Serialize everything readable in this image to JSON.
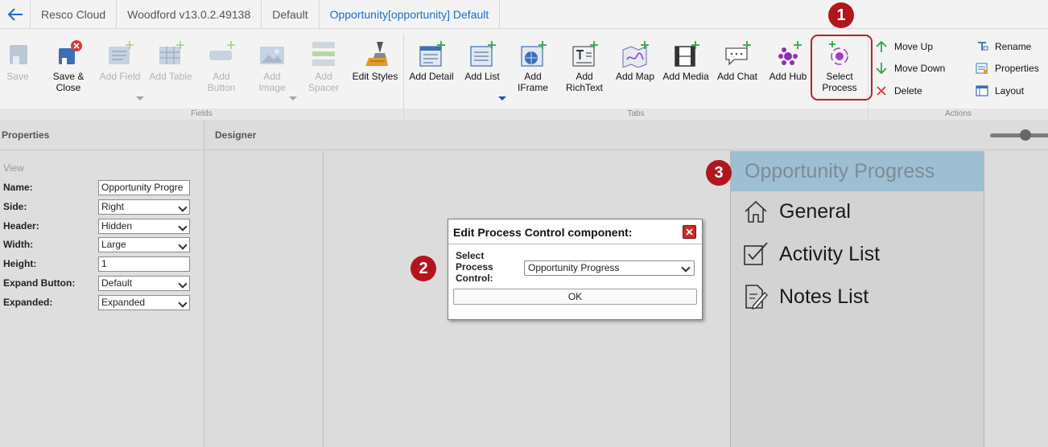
{
  "breadcrumb": {
    "items": [
      "Resco Cloud",
      "Woodford v13.0.2.49138",
      "Default"
    ],
    "active": "Opportunity[opportunity] Default"
  },
  "ribbon": {
    "buttons": {
      "save": "Save",
      "save_close": "Save &\nClose",
      "add_field": "Add Field",
      "add_table": "Add Table",
      "add_button": "Add\nButton",
      "add_image": "Add\nImage",
      "add_spacer": "Add\nSpacer",
      "edit_styles": "Edit Styles",
      "add_detail": "Add Detail",
      "add_list": "Add List",
      "add_iframe": "Add\nIFrame",
      "add_richtext": "Add\nRichText",
      "add_map": "Add Map",
      "add_media": "Add Media",
      "add_chat": "Add Chat",
      "add_hub": "Add Hub",
      "select_process": "Select\nProcess"
    },
    "actions": {
      "move_up": "Move Up",
      "move_down": "Move Down",
      "delete": "Delete",
      "rename": "Rename",
      "properties": "Properties",
      "layout": "Layout"
    },
    "groups": {
      "fields": "Fields",
      "tabs": "Tabs",
      "actions": "Actions"
    }
  },
  "badges": {
    "one": "1",
    "two": "2",
    "three": "3"
  },
  "properties": {
    "title": "Properties",
    "section": "View",
    "rows": [
      {
        "label": "Name:",
        "value": "Opportunity Progre"
      },
      {
        "label": "Side:",
        "value": "Right"
      },
      {
        "label": "Header:",
        "value": "Hidden"
      },
      {
        "label": "Width:",
        "value": "Large"
      },
      {
        "label": "Height:",
        "value": "1"
      },
      {
        "label": "Expand Button:",
        "value": "Default"
      },
      {
        "label": "Expanded:",
        "value": "Expanded"
      }
    ]
  },
  "designer": {
    "title": "Designer",
    "zoom_level": 0.6,
    "tab_header": "Opportunity Progress",
    "tabs": [
      "General",
      "Activity List",
      "Notes List"
    ]
  },
  "dialog": {
    "title": "Edit Process Control component:",
    "label": "Select Process Control:",
    "selected": "Opportunity Progress",
    "ok": "OK"
  },
  "colors": {
    "accent_blue": "#1a6fc4",
    "highlight_red": "#b0262b",
    "tab_header_bg": "#9ebfd3"
  }
}
